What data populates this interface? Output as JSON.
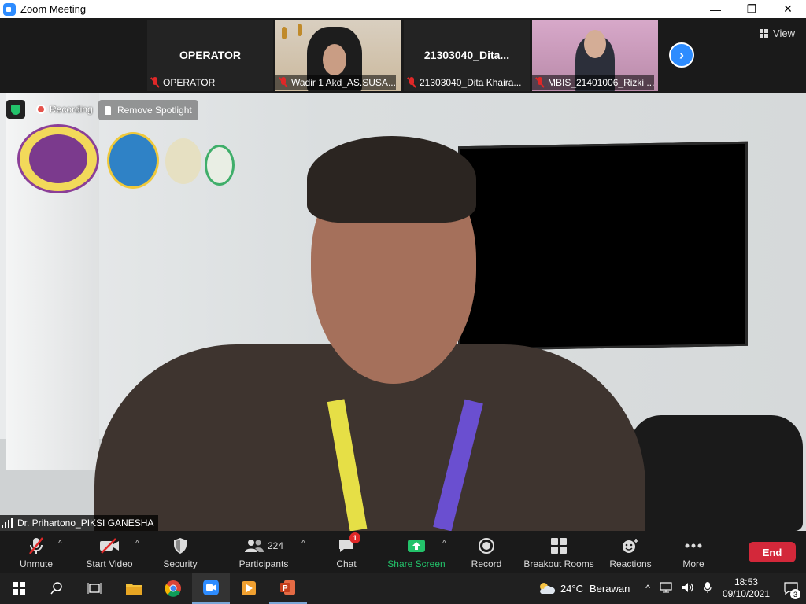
{
  "window": {
    "title": "Zoom Meeting"
  },
  "strip": {
    "thumbnails": [
      {
        "title": "OPERATOR",
        "label": "OPERATOR"
      },
      {
        "title": "",
        "label": "Wadir 1 Akd_AS.SUSA..."
      },
      {
        "title": "21303040_Dita...",
        "label": "21303040_Dita Khaira..."
      },
      {
        "title": "",
        "label": "MBIS_21401006_Rizki ..."
      }
    ],
    "view_label": "View"
  },
  "main": {
    "recording_label": "Recording",
    "remove_spotlight_label": "Remove Spotlight",
    "speaker_name": "Dr. Prihartono_PIKSI GANESHA"
  },
  "toolbar": {
    "unmute": "Unmute",
    "start_video": "Start Video",
    "security": "Security",
    "participants": "Participants",
    "participants_count": "224",
    "chat": "Chat",
    "chat_badge": "1",
    "share_screen": "Share Screen",
    "record": "Record",
    "breakout_rooms": "Breakout Rooms",
    "reactions": "Reactions",
    "more": "More",
    "end": "End"
  },
  "taskbar": {
    "temperature": "24°C",
    "weather": "Berawan",
    "time": "18:53",
    "date": "09/10/2021",
    "notifications": "3"
  },
  "colors": {
    "accent": "#2d8cff",
    "end": "#d3283a",
    "share": "#23c26a",
    "muted": "#e02828"
  }
}
